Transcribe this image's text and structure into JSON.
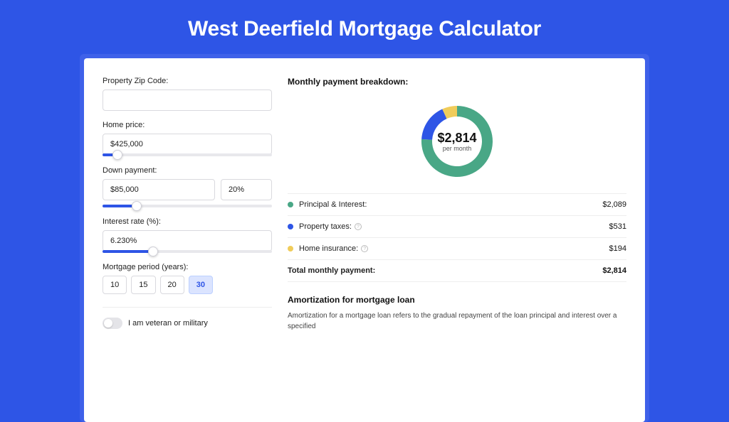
{
  "title": "West Deerfield Mortgage Calculator",
  "form": {
    "zip": {
      "label": "Property Zip Code:",
      "value": ""
    },
    "price": {
      "label": "Home price:",
      "value": "$425,000",
      "slider_pos": 9
    },
    "down": {
      "label": "Down payment:",
      "value": "$85,000",
      "pct": "20%",
      "slider_pos": 20
    },
    "rate": {
      "label": "Interest rate (%):",
      "value": "6.230%",
      "slider_pos": 30
    },
    "period": {
      "label": "Mortgage period (years):",
      "options": [
        "10",
        "15",
        "20",
        "30"
      ],
      "selected": "30"
    },
    "veteran": {
      "label": "I am veteran or military",
      "on": false
    }
  },
  "breakdown": {
    "heading": "Monthly payment breakdown:",
    "center_amount": "$2,814",
    "center_sub": "per month",
    "items": [
      {
        "label": "Principal & Interest:",
        "value": "$2,089",
        "color": "#49a786",
        "info": false
      },
      {
        "label": "Property taxes:",
        "value": "$531",
        "color": "#2e55e6",
        "info": true
      },
      {
        "label": "Home insurance:",
        "value": "$194",
        "color": "#f0cc5a",
        "info": true
      }
    ],
    "total": {
      "label": "Total monthly payment:",
      "value": "$2,814"
    }
  },
  "chart_data": {
    "type": "pie",
    "title": "Monthly payment breakdown",
    "series": [
      {
        "name": "Principal & Interest",
        "value": 2089,
        "color": "#49a786"
      },
      {
        "name": "Property taxes",
        "value": 531,
        "color": "#2e55e6"
      },
      {
        "name": "Home insurance",
        "value": 194,
        "color": "#f0cc5a"
      }
    ],
    "total": 2814,
    "center_label": "$2,814 per month"
  },
  "amort": {
    "heading": "Amortization for mortgage loan",
    "text": "Amortization for a mortgage loan refers to the gradual repayment of the loan principal and interest over a specified"
  }
}
